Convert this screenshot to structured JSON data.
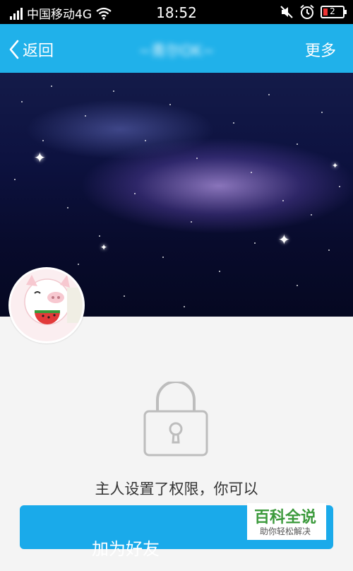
{
  "status_bar": {
    "carrier": "中国移动4G",
    "time": "18:52",
    "battery": "2"
  },
  "nav": {
    "back_label": "返回",
    "title": "~青尔OK~",
    "more_label": "更多"
  },
  "profile": {
    "permission_text": "主人设置了权限，你可以",
    "add_friend_label": "加为好友"
  },
  "watermark": {
    "title": "百科全说",
    "subtitle": "助你轻松解决"
  }
}
